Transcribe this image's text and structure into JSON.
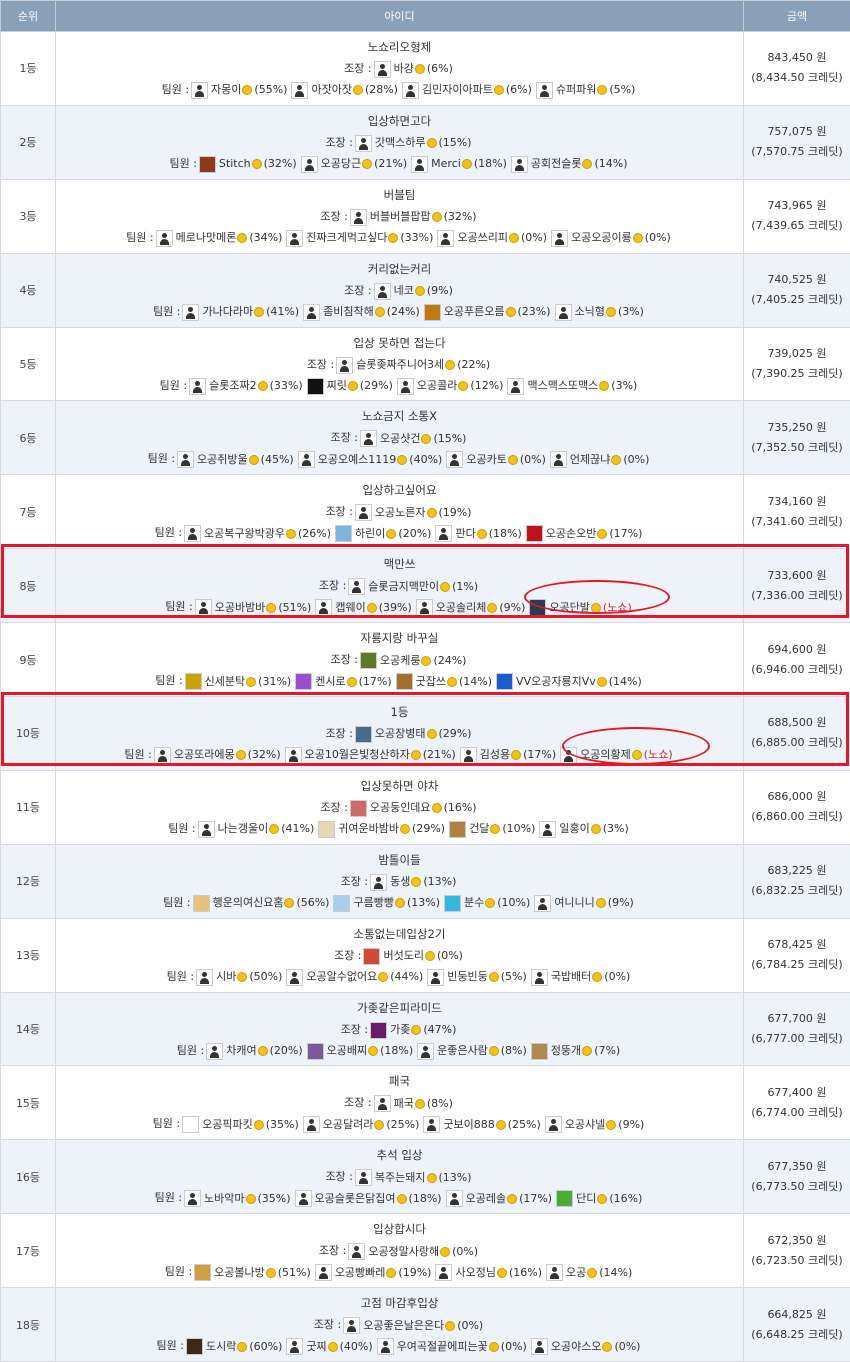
{
  "header": {
    "rank": "순위",
    "id": "아이디",
    "amount": "금액"
  },
  "labels": {
    "leader": "조장 :",
    "members": "팀원 :",
    "won_suffix": " 원",
    "credit_suffix": " 크레딧)",
    "noshow": "(노쇼)"
  },
  "colors": {
    "header_bg": "#8a9fb8",
    "coin": "#f2c21b",
    "highlight": "#e5172a"
  },
  "rows": [
    {
      "rank": "1등",
      "team": "노쇼리오형제",
      "leader": {
        "name": "바걍",
        "pct": "(6%)",
        "av": "default"
      },
      "members": [
        {
          "name": "자몽이",
          "pct": "(55%)",
          "av": "default"
        },
        {
          "name": "아잣아잣",
          "pct": "(28%)",
          "av": "default"
        },
        {
          "name": "김민자이아파트",
          "pct": "(6%)",
          "av": "default"
        },
        {
          "name": "슈퍼파워",
          "pct": "(5%)",
          "av": "default"
        }
      ],
      "won": "843,450",
      "credit": "(8,434.50"
    },
    {
      "rank": "2등",
      "team": "입상하면고다",
      "leader": {
        "name": "갓맥스하루",
        "pct": "(15%)",
        "av": "default"
      },
      "members": [
        {
          "name": "Stitch",
          "pct": "(32%)",
          "av": "#8b3a1a"
        },
        {
          "name": "오공당근",
          "pct": "(21%)",
          "av": "default"
        },
        {
          "name": "Merci",
          "pct": "(18%)",
          "av": "default"
        },
        {
          "name": "공회전슬롯",
          "pct": "(14%)",
          "av": "default"
        }
      ],
      "won": "757,075",
      "credit": "(7,570.75"
    },
    {
      "rank": "3등",
      "team": "버블팀",
      "leader": {
        "name": "버블버블팝팝",
        "pct": "(32%)",
        "av": "default"
      },
      "members": [
        {
          "name": "메로나맛메론",
          "pct": "(34%)",
          "av": "default"
        },
        {
          "name": "진짜크게먹고싶다",
          "pct": "(33%)",
          "av": "default"
        },
        {
          "name": "오공쓰리피",
          "pct": "(0%)",
          "av": "default"
        },
        {
          "name": "오공오공이룡",
          "pct": "(0%)",
          "av": "default"
        }
      ],
      "won": "743,965",
      "credit": "(7,439.65"
    },
    {
      "rank": "4등",
      "team": "커리없는커리",
      "leader": {
        "name": "네코",
        "pct": "(9%)",
        "av": "default"
      },
      "members": [
        {
          "name": "가나다라마",
          "pct": "(41%)",
          "av": "default"
        },
        {
          "name": "좀비침착해",
          "pct": "(24%)",
          "av": "default"
        },
        {
          "name": "오공푸른오름",
          "pct": "(23%)",
          "av": "#c07a10"
        },
        {
          "name": "소닉형",
          "pct": "(3%)",
          "av": "default"
        }
      ],
      "won": "740,525",
      "credit": "(7,405.25"
    },
    {
      "rank": "5등",
      "team": "입상 못하면 접는다",
      "leader": {
        "name": "슬롯좆짜주니어3세",
        "pct": "(22%)",
        "av": "default"
      },
      "members": [
        {
          "name": "슬롯조짜2",
          "pct": "(33%)",
          "av": "default"
        },
        {
          "name": "찌릿",
          "pct": "(29%)",
          "av": "#111111"
        },
        {
          "name": "오공콜라",
          "pct": "(12%)",
          "av": "default"
        },
        {
          "name": "맥스맥스또맥스",
          "pct": "(3%)",
          "av": "default"
        }
      ],
      "won": "739,025",
      "credit": "(7,390.25"
    },
    {
      "rank": "6등",
      "team": "노쇼금지 소통X",
      "leader": {
        "name": "오공샷건",
        "pct": "(15%)",
        "av": "default"
      },
      "members": [
        {
          "name": "오공쥐방울",
          "pct": "(45%)",
          "av": "default"
        },
        {
          "name": "오공오예스1119",
          "pct": "(40%)",
          "av": "default"
        },
        {
          "name": "오공카토",
          "pct": "(0%)",
          "av": "default"
        },
        {
          "name": "언제끊냐",
          "pct": "(0%)",
          "av": "default"
        }
      ],
      "won": "735,250",
      "credit": "(7,352.50"
    },
    {
      "rank": "7등",
      "team": "입상하고싶어요",
      "leader": {
        "name": "오공노른자",
        "pct": "(19%)",
        "av": "default"
      },
      "members": [
        {
          "name": "오공복구왕박광우",
          "pct": "(26%)",
          "av": "default"
        },
        {
          "name": "하린이",
          "pct": "(20%)",
          "av": "#7fb3e0"
        },
        {
          "name": "판다",
          "pct": "(18%)",
          "av": "default"
        },
        {
          "name": "오공손오반",
          "pct": "(17%)",
          "av": "#c0121a"
        }
      ],
      "won": "734,160",
      "credit": "(7,341.60"
    },
    {
      "rank": "8등",
      "team": "맥만쓰",
      "leader": {
        "name": "슬롯금지맥만이",
        "pct": "(1%)",
        "av": "default"
      },
      "members": [
        {
          "name": "오공바밤바",
          "pct": "(51%)",
          "av": "default"
        },
        {
          "name": "캡웨이",
          "pct": "(39%)",
          "av": "default"
        },
        {
          "name": "오공솔리체",
          "pct": "(9%)",
          "av": "default"
        },
        {
          "name": "오공단발",
          "pct": "",
          "av": "#2b3a55",
          "noshow": true
        }
      ],
      "won": "733,600",
      "credit": "(7,336.00"
    },
    {
      "rank": "9등",
      "team": "자룡지랑 바꾸실",
      "leader": {
        "name": "오공케룽",
        "pct": "(24%)",
        "av": "#5d7a2a"
      },
      "members": [
        {
          "name": "신세분탁",
          "pct": "(31%)",
          "av": "#c9a400"
        },
        {
          "name": "켄시로",
          "pct": "(17%)",
          "av": "#9b4dd0"
        },
        {
          "name": "굿잡쓰",
          "pct": "(14%)",
          "av": "#a0702a"
        },
        {
          "name": "VV오공자룡지Vv",
          "pct": "(14%)",
          "av": "#1a5bd0"
        }
      ],
      "won": "694,600",
      "credit": "(6,946.00"
    },
    {
      "rank": "10등",
      "team": "1등",
      "leader": {
        "name": "오공장병태",
        "pct": "(29%)",
        "av": "#4a6a8a"
      },
      "members": [
        {
          "name": "오공또라에몽",
          "pct": "(32%)",
          "av": "default"
        },
        {
          "name": "오공10월은빛청산하자",
          "pct": "(21%)",
          "av": "default"
        },
        {
          "name": "김성용",
          "pct": "(17%)",
          "av": "default"
        },
        {
          "name": "오공의황제",
          "pct": "",
          "av": "default",
          "noshow": true
        }
      ],
      "won": "688,500",
      "credit": "(6,885.00"
    },
    {
      "rank": "11등",
      "team": "입상못하면 야차",
      "leader": {
        "name": "오공둥인데요",
        "pct": "(16%)",
        "av": "#d06a6a"
      },
      "members": [
        {
          "name": "나는갱울이",
          "pct": "(41%)",
          "av": "default"
        },
        {
          "name": "귀여운바밤바",
          "pct": "(29%)",
          "av": "#e8d8b0"
        },
        {
          "name": "건달",
          "pct": "(10%)",
          "av": "#b08040"
        },
        {
          "name": "일홍이",
          "pct": "(3%)",
          "av": "default"
        }
      ],
      "won": "686,000",
      "credit": "(6,860.00"
    },
    {
      "rank": "12등",
      "team": "밤톨이들",
      "leader": {
        "name": "동생",
        "pct": "(13%)",
        "av": "default"
      },
      "members": [
        {
          "name": "행운의여신요홈",
          "pct": "(56%)",
          "av": "#e6c27a"
        },
        {
          "name": "구름빵빵",
          "pct": "(13%)",
          "av": "#a9d0ea"
        },
        {
          "name": "분수",
          "pct": "(10%)",
          "av": "#30b8e0"
        },
        {
          "name": "여니니니",
          "pct": "(9%)",
          "av": "default"
        }
      ],
      "won": "683,225",
      "credit": "(6,832.25"
    },
    {
      "rank": "13등",
      "team": "소통없는데입상2기",
      "leader": {
        "name": "버섯도리",
        "pct": "(0%)",
        "av": "#d04a3a"
      },
      "members": [
        {
          "name": "시바",
          "pct": "(50%)",
          "av": "default"
        },
        {
          "name": "오공알수없어요",
          "pct": "(44%)",
          "av": "default"
        },
        {
          "name": "빈둥빈둥",
          "pct": "(5%)",
          "av": "default"
        },
        {
          "name": "국밥배터",
          "pct": "(0%)",
          "av": "default"
        }
      ],
      "won": "678,425",
      "credit": "(6,784.25"
    },
    {
      "rank": "14등",
      "team": "가좆같은피라미드",
      "leader": {
        "name": "가좆",
        "pct": "(47%)",
        "av": "#6a1a6a"
      },
      "members": [
        {
          "name": "차캐여",
          "pct": "(20%)",
          "av": "default"
        },
        {
          "name": "오공배찌",
          "pct": "(18%)",
          "av": "#7a5a9a"
        },
        {
          "name": "운좋은사람",
          "pct": "(8%)",
          "av": "default"
        },
        {
          "name": "정뚱개",
          "pct": "(7%)",
          "av": "#b08a50"
        }
      ],
      "won": "677,700",
      "credit": "(6,777.00"
    },
    {
      "rank": "15등",
      "team": "패국",
      "leader": {
        "name": "패국",
        "pct": "(8%)",
        "av": "default"
      },
      "members": [
        {
          "name": "오공픽파킷",
          "pct": "(35%)",
          "av": "#ffffff"
        },
        {
          "name": "오공달려라",
          "pct": "(25%)",
          "av": "default"
        },
        {
          "name": "굿보이888",
          "pct": "(25%)",
          "av": "default"
        },
        {
          "name": "오공샤넬",
          "pct": "(9%)",
          "av": "default"
        }
      ],
      "won": "677,400",
      "credit": "(6,774.00"
    },
    {
      "rank": "16등",
      "team": "추석 입상",
      "leader": {
        "name": "복주는돼지",
        "pct": "(13%)",
        "av": "default"
      },
      "members": [
        {
          "name": "노바악마",
          "pct": "(35%)",
          "av": "default"
        },
        {
          "name": "오공슬롯은닭집여",
          "pct": "(18%)",
          "av": "default"
        },
        {
          "name": "오공레솔",
          "pct": "(17%)",
          "av": "default"
        },
        {
          "name": "단디",
          "pct": "(16%)",
          "av": "#4caa3a"
        }
      ],
      "won": "677,350",
      "credit": "(6,773.50"
    },
    {
      "rank": "17등",
      "team": "입상합시다",
      "leader": {
        "name": "오공정말사랑해",
        "pct": "(0%)",
        "av": "default"
      },
      "members": [
        {
          "name": "오공볼나방",
          "pct": "(51%)",
          "av": "#d0a040"
        },
        {
          "name": "오공빵빠레",
          "pct": "(19%)",
          "av": "default"
        },
        {
          "name": "사오정님",
          "pct": "(16%)",
          "av": "default"
        },
        {
          "name": "오공",
          "pct": "(14%)",
          "av": "default"
        }
      ],
      "won": "672,350",
      "credit": "(6,723.50"
    },
    {
      "rank": "18등",
      "team": "고점 마감후입상",
      "leader": {
        "name": "오공좋은날은온다",
        "pct": "(0%)",
        "av": "default"
      },
      "members": [
        {
          "name": "도시락",
          "pct": "(60%)",
          "av": "#3a2a1a"
        },
        {
          "name": "굿찌",
          "pct": "(40%)",
          "av": "default"
        },
        {
          "name": "우여곡절끝에피는꽃",
          "pct": "(0%)",
          "av": "default"
        },
        {
          "name": "오공야스오",
          "pct": "(0%)",
          "av": "default"
        }
      ],
      "won": "664,825",
      "credit": "(6,648.25"
    }
  ]
}
